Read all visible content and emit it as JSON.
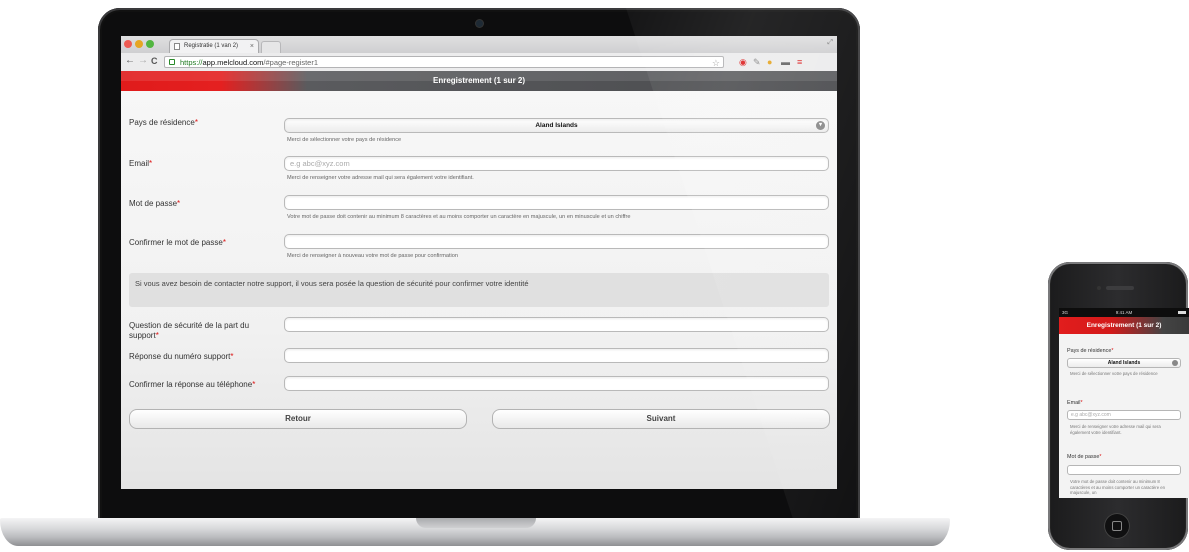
{
  "browser": {
    "tab_title": "Registratie (1 van 2)",
    "tab_close": "×",
    "url_scheme": "https://",
    "url_host": "app.melcloud.com",
    "url_path": "/#page-register1",
    "back": "←",
    "forward": "→",
    "reload": "C"
  },
  "page": {
    "header_title": "Enregistrement (1 sur 2)",
    "fields": [
      {
        "label": "Pays de résidence",
        "required": "*",
        "value": "Aland Islands",
        "placeholder": "",
        "help": "Merci de sélectionner votre pays de résidence"
      },
      {
        "label": "Email",
        "required": "*",
        "value": "",
        "placeholder": "e.g abc@xyz.com",
        "help": "Merci de renseigner votre adresse mail qui sera également votre identifiant."
      },
      {
        "label": "Mot de passe",
        "required": "*",
        "value": "",
        "placeholder": "",
        "help": "Votre mot de passe doit contenir au minimum 8 caractères et au moins comporter un caractère en majuscule, un en minuscule et un chiffre"
      },
      {
        "label": "Confirmer le mot de passe",
        "required": "*",
        "value": "",
        "placeholder": "",
        "help": "Merci de renseigner à nouveau votre mot de passe pour confirmation"
      }
    ],
    "info_text": "Si vous avez besoin de contacter notre support, il vous sera posée la question de sécurité pour confirmer votre identité",
    "security": [
      {
        "label": "Question de sécurité de la part du support",
        "required": "*"
      },
      {
        "label": "Réponse du numéro support",
        "required": "*"
      },
      {
        "label": "Confirmer la réponse au téléphone",
        "required": "*"
      }
    ],
    "buttons": {
      "back": "Retour",
      "next": "Suivant"
    }
  },
  "phone": {
    "status_signal": "3G",
    "status_time": "9:41 AM",
    "header_title": "Enregistrement (1 sur 2)",
    "country_label": "Pays de résidence",
    "country_value": "Aland Islands",
    "country_help": "Merci de sélectionner votre pays de résidence",
    "email_label": "Email",
    "email_placeholder": "e.g abc@xyz.com",
    "email_help": "Merci de renseigner votre adresse mail qui sera également votre identifiant.",
    "password_label": "Mot de passe",
    "password_help": "Votre mot de passe doit contenir au minimum 8 caractères et au moins comporter un caractère en majuscule, un",
    "required": "*"
  },
  "colors": {
    "brand_red": "#e01b1b",
    "header_gray": "#4a4b4e"
  }
}
